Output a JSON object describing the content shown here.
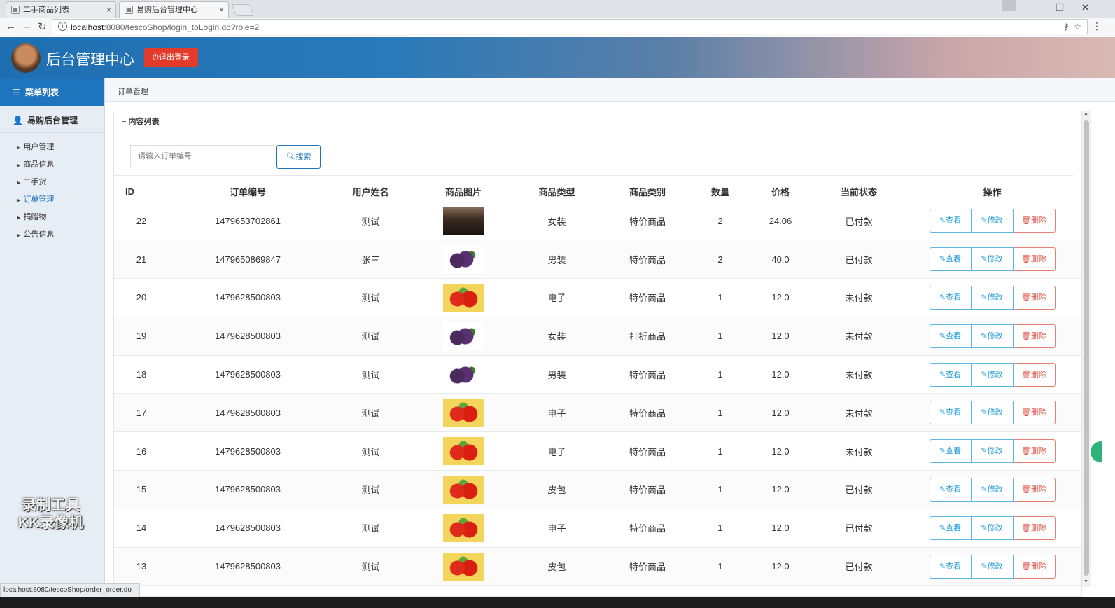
{
  "browser": {
    "tabs": [
      {
        "title": "二手商品列表",
        "active": false
      },
      {
        "title": "易购后台管理中心",
        "active": true
      }
    ],
    "url_host": "localhost",
    "url_rest": ":8080/tescoShop/login_toLogin.do?role=2",
    "status_url": "localhost:8080/tescoShop/order_order.do"
  },
  "header": {
    "title": "后台管理中心",
    "logout_label": "退出登录",
    "colors": {
      "header_start": "#1e6fb2",
      "header_end": "#d9b9b4",
      "logout_bg": "#e23b2b"
    }
  },
  "sidebar": {
    "menu_title": "菜单列表",
    "group_title": "易购后台管理",
    "items": [
      {
        "label": "用户管理"
      },
      {
        "label": "商品信息"
      },
      {
        "label": "二手货"
      },
      {
        "label": "订单管理"
      },
      {
        "label": "捐赠物"
      },
      {
        "label": "公告信息"
      }
    ],
    "watermark": {
      "line1": "录制工具",
      "line2": "KK录像机"
    }
  },
  "breadcrumb": "订单管理",
  "panel": {
    "title": "内容列表",
    "search_placeholder": "请输入订单编号",
    "search_button": "搜索"
  },
  "table": {
    "columns": [
      "ID",
      "订单编号",
      "用户姓名",
      "商品图片",
      "商品类型",
      "商品类别",
      "数量",
      "价格",
      "当前状态",
      "操作"
    ],
    "rows": [
      {
        "id": "22",
        "order_no": "1479653702861",
        "user": "测试",
        "image": "photo",
        "type": "女装",
        "category": "特价商品",
        "qty": "2",
        "price": "24.06",
        "status": "已付款"
      },
      {
        "id": "21",
        "order_no": "1479650869847",
        "user": "张三",
        "image": "grape",
        "type": "男装",
        "category": "特价商品",
        "qty": "2",
        "price": "40.0",
        "status": "已付款"
      },
      {
        "id": "20",
        "order_no": "1479628500803",
        "user": "测试",
        "image": "strawberry",
        "type": "电子",
        "category": "特价商品",
        "qty": "1",
        "price": "12.0",
        "status": "未付款"
      },
      {
        "id": "19",
        "order_no": "1479628500803",
        "user": "测试",
        "image": "grape",
        "type": "女装",
        "category": "打折商品",
        "qty": "1",
        "price": "12.0",
        "status": "未付款"
      },
      {
        "id": "18",
        "order_no": "1479628500803",
        "user": "测试",
        "image": "grape",
        "type": "男装",
        "category": "特价商品",
        "qty": "1",
        "price": "12.0",
        "status": "未付款"
      },
      {
        "id": "17",
        "order_no": "1479628500803",
        "user": "测试",
        "image": "strawberry",
        "type": "电子",
        "category": "特价商品",
        "qty": "1",
        "price": "12.0",
        "status": "未付款"
      },
      {
        "id": "16",
        "order_no": "1479628500803",
        "user": "测试",
        "image": "strawberry",
        "type": "电子",
        "category": "特价商品",
        "qty": "1",
        "price": "12.0",
        "status": "未付款"
      },
      {
        "id": "15",
        "order_no": "1479628500803",
        "user": "测试",
        "image": "strawberry",
        "type": "皮包",
        "category": "特价商品",
        "qty": "1",
        "price": "12.0",
        "status": "已付款"
      },
      {
        "id": "14",
        "order_no": "1479628500803",
        "user": "测试",
        "image": "strawberry",
        "type": "电子",
        "category": "特价商品",
        "qty": "1",
        "price": "12.0",
        "status": "已付款"
      },
      {
        "id": "13",
        "order_no": "1479628500803",
        "user": "测试",
        "image": "strawberry",
        "type": "皮包",
        "category": "特价商品",
        "qty": "1",
        "price": "12.0",
        "status": "已付款"
      }
    ],
    "actions": {
      "view": "查看",
      "edit": "修改",
      "delete": "删除"
    },
    "colors": {
      "view": "#1e9bd7",
      "edit": "#1e9bd7",
      "delete": "#e2544a"
    }
  }
}
